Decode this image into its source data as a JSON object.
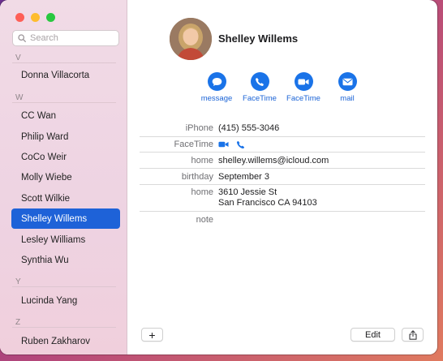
{
  "window": {
    "controls": [
      "close",
      "minimize",
      "zoom"
    ]
  },
  "search": {
    "placeholder": "Search",
    "value": ""
  },
  "sidebar": {
    "sections": [
      {
        "letter": "V",
        "contacts": [
          "Donna Villacorta"
        ]
      },
      {
        "letter": "W",
        "contacts": [
          "CC Wan",
          "Philip Ward",
          "CoCo Weir",
          "Molly Wiebe",
          "Scott Wilkie",
          "Shelley Willems",
          "Lesley Williams",
          "Synthia Wu"
        ]
      },
      {
        "letter": "Y",
        "contacts": [
          "Lucinda Yang"
        ]
      },
      {
        "letter": "Z",
        "contacts": [
          "Ruben Zakharov"
        ]
      }
    ],
    "selected": "Shelley Willems"
  },
  "card": {
    "name": "Shelley Willems",
    "actions": {
      "message": "message",
      "facetime_video": "FaceTime",
      "facetime_audio": "FaceTime",
      "mail": "mail"
    },
    "fields": {
      "phone_label": "iPhone",
      "phone_value": "(415) 555-3046",
      "facetime_label": "FaceTime",
      "email_label": "home",
      "email_value": "shelley.willems@icloud.com",
      "birthday_label": "birthday",
      "birthday_value": "September 3",
      "address_label": "home",
      "address_line1": "3610 Jessie St",
      "address_line2": "San Francisco CA 94103",
      "note_label": "note",
      "note_value": ""
    }
  },
  "footer": {
    "add_label": "+",
    "edit_label": "Edit"
  },
  "colors": {
    "accent": "#1a73e8",
    "selection": "#1e62d8",
    "sidebar_bg": "#f1dbe6"
  },
  "icons": [
    "search-icon",
    "message-icon",
    "video-icon",
    "phone-icon",
    "mail-icon",
    "share-icon"
  ]
}
